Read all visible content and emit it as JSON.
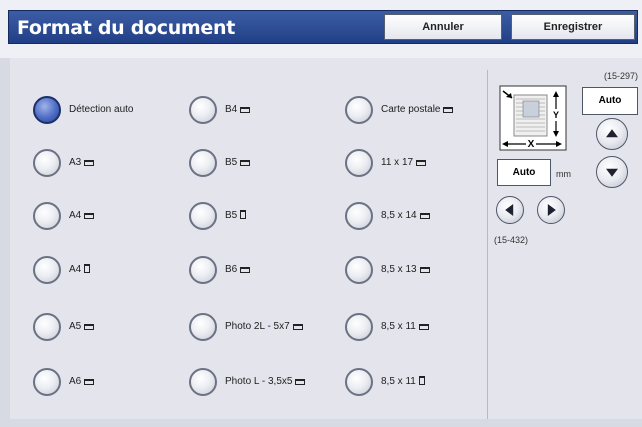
{
  "header": {
    "title": "Format du document",
    "cancel_label": "Annuler",
    "save_label": "Enregistrer"
  },
  "options": {
    "col1": [
      {
        "label": "Détection auto",
        "orientation": "none",
        "selected": true
      },
      {
        "label": "A3",
        "orientation": "landscape",
        "selected": false
      },
      {
        "label": "A4",
        "orientation": "landscape",
        "selected": false
      },
      {
        "label": "A4",
        "orientation": "portrait",
        "selected": false
      },
      {
        "label": "A5",
        "orientation": "landscape",
        "selected": false
      },
      {
        "label": "A6",
        "orientation": "landscape",
        "selected": false
      }
    ],
    "col2": [
      {
        "label": "B4",
        "orientation": "landscape",
        "selected": false
      },
      {
        "label": "B5",
        "orientation": "landscape",
        "selected": false
      },
      {
        "label": "B5",
        "orientation": "portrait",
        "selected": false
      },
      {
        "label": "B6",
        "orientation": "landscape",
        "selected": false
      },
      {
        "label": "Photo 2L - 5x7",
        "orientation": "landscape",
        "selected": false
      },
      {
        "label": "Photo L - 3,5x5",
        "orientation": "landscape",
        "selected": false
      }
    ],
    "col3": [
      {
        "label": "Carte postale",
        "orientation": "landscape",
        "selected": false
      },
      {
        "label": "11 x 17",
        "orientation": "landscape",
        "selected": false
      },
      {
        "label": "8,5 x 14",
        "orientation": "landscape",
        "selected": false
      },
      {
        "label": "8,5 x 13",
        "orientation": "landscape",
        "selected": false
      },
      {
        "label": "8,5 x 11",
        "orientation": "landscape",
        "selected": false
      },
      {
        "label": "8,5 x 11",
        "orientation": "portrait",
        "selected": false
      }
    ]
  },
  "custom": {
    "y_range": "(15-297)",
    "y_value": "Auto",
    "y_unit": "mm",
    "x_value": "Auto",
    "x_unit": "mm",
    "x_range": "(15-432)",
    "diagram_x": "X",
    "diagram_y": "Y"
  },
  "colors": {
    "title_bar": "#2c4c96",
    "selected_radio": "#3e5eb8",
    "panel_bg": "#e3e4ec"
  }
}
